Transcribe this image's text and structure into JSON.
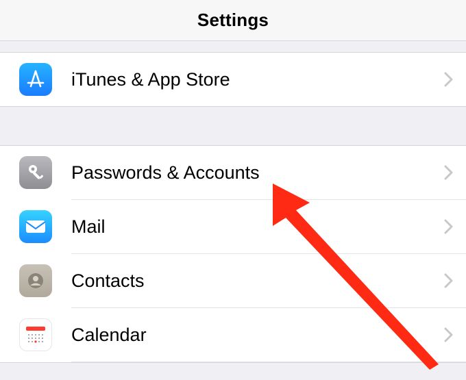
{
  "header": {
    "title": "Settings"
  },
  "groupA": {
    "items": [
      {
        "id": "itunes-appstore",
        "label": "iTunes & App Store",
        "icon": "appstore"
      }
    ]
  },
  "groupB": {
    "items": [
      {
        "id": "passwords-accounts",
        "label": "Passwords & Accounts",
        "icon": "key"
      },
      {
        "id": "mail",
        "label": "Mail",
        "icon": "mail"
      },
      {
        "id": "contacts",
        "label": "Contacts",
        "icon": "contacts"
      },
      {
        "id": "calendar",
        "label": "Calendar",
        "icon": "calendar"
      }
    ]
  },
  "annotation": {
    "arrow_color": "#ff2a13",
    "target": "passwords-accounts"
  }
}
